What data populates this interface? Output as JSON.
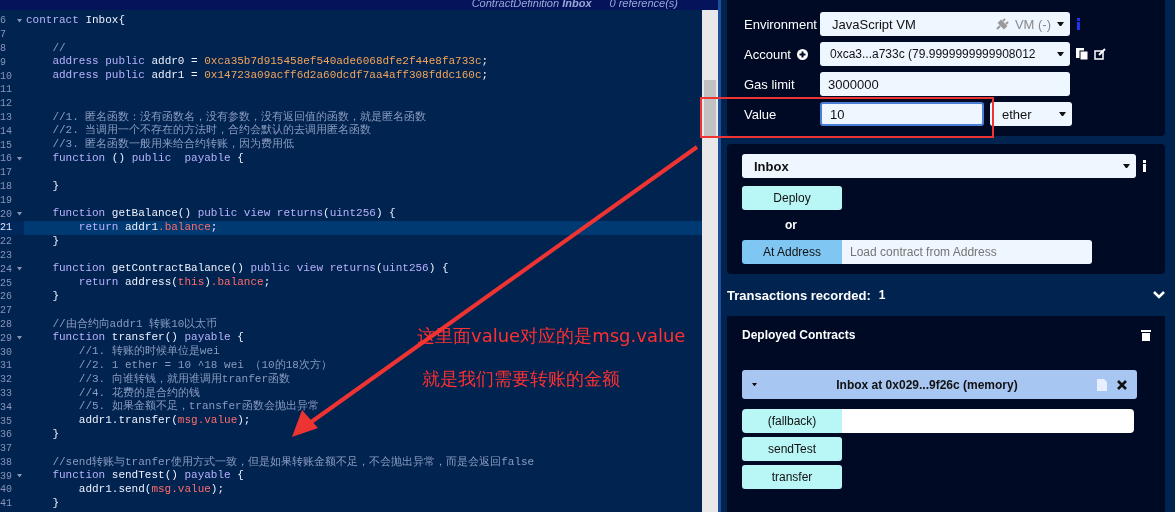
{
  "editor": {
    "header": {
      "symbol": "ContractDefinition",
      "name": "Inbox",
      "references": "0 reference(s)"
    },
    "lines": [
      {
        "number": "6",
        "foldable": true,
        "highlighted": false,
        "tokens": [
          {
            "kind": "keyword",
            "text": "contract"
          },
          {
            "kind": "text",
            "text": " Inbox{"
          }
        ]
      },
      {
        "number": "7",
        "foldable": false,
        "highlighted": false
      },
      {
        "number": "8",
        "foldable": false,
        "highlighted": false,
        "tokens": [
          {
            "kind": "comment",
            "text": "    //"
          }
        ]
      },
      {
        "number": "9",
        "foldable": false,
        "highlighted": false,
        "tokens": [
          {
            "kind": "keyword",
            "text": "    address public"
          },
          {
            "kind": "text",
            "text": " addr0 = "
          },
          {
            "kind": "number",
            "text": "0xca35b7d915458ef540ade6068dfe2f44e8fa733c"
          },
          {
            "kind": "text",
            "text": ";"
          }
        ]
      },
      {
        "number": "10",
        "foldable": false,
        "highlighted": false,
        "tokens": [
          {
            "kind": "keyword",
            "text": "    address public"
          },
          {
            "kind": "text",
            "text": " addr1 = "
          },
          {
            "kind": "number",
            "text": "0x14723a09acff6d2a60dcdf7aa4aff308fddc160c"
          },
          {
            "kind": "text",
            "text": ";"
          }
        ]
      },
      {
        "number": "11",
        "foldable": false,
        "highlighted": false
      },
      {
        "number": "12",
        "foldable": false,
        "highlighted": false
      },
      {
        "number": "13",
        "foldable": false,
        "highlighted": false,
        "tokens": [
          {
            "kind": "comment",
            "text": "    //1. 匿名函数：没有函数名，没有参数，没有返回值的函数，就是匿名函数"
          }
        ]
      },
      {
        "number": "14",
        "foldable": false,
        "highlighted": false,
        "tokens": [
          {
            "kind": "comment",
            "text": "    //2. 当调用一个不存在的方法时，合约会默认的去调用匿名函数"
          }
        ]
      },
      {
        "number": "15",
        "foldable": false,
        "highlighted": false,
        "tokens": [
          {
            "kind": "comment",
            "text": "    //3. 匿名函数一般用来给合约转账，因为费用低"
          }
        ]
      },
      {
        "number": "16",
        "foldable": true,
        "highlighted": false,
        "tokens": [
          {
            "kind": "keyword",
            "text": "    function"
          },
          {
            "kind": "text",
            "text": " () "
          },
          {
            "kind": "keyword",
            "text": "public  payable"
          },
          {
            "kind": "text",
            "text": " {"
          }
        ]
      },
      {
        "number": "17",
        "foldable": false,
        "highlighted": false
      },
      {
        "number": "18",
        "foldable": false,
        "highlighted": false,
        "tokens": [
          {
            "kind": "text",
            "text": "    }"
          }
        ]
      },
      {
        "number": "19",
        "foldable": false,
        "highlighted": false
      },
      {
        "number": "20",
        "foldable": true,
        "highlighted": false,
        "tokens": [
          {
            "kind": "keyword",
            "text": "    function"
          },
          {
            "kind": "text",
            "text": " getBalance() "
          },
          {
            "kind": "keyword",
            "text": "public view returns"
          },
          {
            "kind": "text",
            "text": "("
          },
          {
            "kind": "keyword",
            "text": "uint256"
          },
          {
            "kind": "text",
            "text": ") {"
          }
        ]
      },
      {
        "number": "21",
        "foldable": false,
        "highlighted": true,
        "tokens": [
          {
            "kind": "keyword",
            "text": "        return"
          },
          {
            "kind": "text",
            "text": " addr1"
          },
          {
            "kind": "member",
            "text": ".balance"
          },
          {
            "kind": "text",
            "text": ";"
          }
        ]
      },
      {
        "number": "22",
        "foldable": false,
        "highlighted": false,
        "tokens": [
          {
            "kind": "text",
            "text": "    }"
          }
        ]
      },
      {
        "number": "23",
        "foldable": false,
        "highlighted": false
      },
      {
        "number": "24",
        "foldable": true,
        "highlighted": false,
        "tokens": [
          {
            "kind": "keyword",
            "text": "    function"
          },
          {
            "kind": "text",
            "text": " getContractBalance() "
          },
          {
            "kind": "keyword",
            "text": "public view returns"
          },
          {
            "kind": "text",
            "text": "("
          },
          {
            "kind": "keyword",
            "text": "uint256"
          },
          {
            "kind": "text",
            "text": ") {"
          }
        ]
      },
      {
        "number": "25",
        "foldable": false,
        "highlighted": false,
        "tokens": [
          {
            "kind": "keyword",
            "text": "        return"
          },
          {
            "kind": "text",
            "text": " address("
          },
          {
            "kind": "member",
            "text": "this"
          },
          {
            "kind": "text",
            "text": ")"
          },
          {
            "kind": "member",
            "text": ".balance"
          },
          {
            "kind": "text",
            "text": ";"
          }
        ]
      },
      {
        "number": "26",
        "foldable": false,
        "highlighted": false,
        "tokens": [
          {
            "kind": "text",
            "text": "    }"
          }
        ]
      },
      {
        "number": "27",
        "foldable": false,
        "highlighted": false
      },
      {
        "number": "28",
        "foldable": false,
        "highlighted": false,
        "tokens": [
          {
            "kind": "comment",
            "text": "    //由合约向addr1 转账10以太币"
          }
        ]
      },
      {
        "number": "29",
        "foldable": true,
        "highlighted": false,
        "tokens": [
          {
            "kind": "keyword",
            "text": "    function"
          },
          {
            "kind": "text",
            "text": " transfer() "
          },
          {
            "kind": "keyword",
            "text": "payable"
          },
          {
            "kind": "text",
            "text": " {"
          }
        ]
      },
      {
        "number": "30",
        "foldable": false,
        "highlighted": false,
        "tokens": [
          {
            "kind": "comment",
            "text": "        //1. 转账的时候单位是wei"
          }
        ]
      },
      {
        "number": "31",
        "foldable": false,
        "highlighted": false,
        "tokens": [
          {
            "kind": "comment",
            "text": "        //2. 1 ether = 10 ^18 wei （10的18次方）"
          }
        ]
      },
      {
        "number": "32",
        "foldable": false,
        "highlighted": false,
        "tokens": [
          {
            "kind": "comment",
            "text": "        //3. 向谁转钱，就用谁调用tranfer函数"
          }
        ]
      },
      {
        "number": "33",
        "foldable": false,
        "highlighted": false,
        "tokens": [
          {
            "kind": "comment",
            "text": "        //4. 花费的是合约的钱"
          }
        ]
      },
      {
        "number": "34",
        "foldable": false,
        "highlighted": false,
        "tokens": [
          {
            "kind": "comment",
            "text": "        //5. 如果金额不足，transfer函数会抛出异常"
          }
        ]
      },
      {
        "number": "35",
        "foldable": false,
        "highlighted": false,
        "tokens": [
          {
            "kind": "text",
            "text": "        addr1.transfer("
          },
          {
            "kind": "member",
            "text": "msg.value"
          },
          {
            "kind": "text",
            "text": ");"
          }
        ]
      },
      {
        "number": "36",
        "foldable": false,
        "highlighted": false,
        "tokens": [
          {
            "kind": "text",
            "text": "    }"
          }
        ]
      },
      {
        "number": "37",
        "foldable": false,
        "highlighted": false
      },
      {
        "number": "38",
        "foldable": false,
        "highlighted": false,
        "tokens": [
          {
            "kind": "comment",
            "text": "    //send转账与tranfer使用方式一致，但是如果转账金额不足，不会抛出异常，而是会返回false"
          }
        ]
      },
      {
        "number": "39",
        "foldable": true,
        "highlighted": false,
        "tokens": [
          {
            "kind": "keyword",
            "text": "    function"
          },
          {
            "kind": "text",
            "text": " sendTest() "
          },
          {
            "kind": "keyword",
            "text": "payable"
          },
          {
            "kind": "text",
            "text": " {"
          }
        ]
      },
      {
        "number": "40",
        "foldable": false,
        "highlighted": false,
        "tokens": [
          {
            "kind": "text",
            "text": "        addr1.send("
          },
          {
            "kind": "member",
            "text": "msg.value"
          },
          {
            "kind": "text",
            "text": ");"
          }
        ]
      },
      {
        "number": "41",
        "foldable": false,
        "highlighted": false,
        "tokens": [
          {
            "kind": "text",
            "text": "    }"
          }
        ]
      }
    ]
  },
  "run_panel": {
    "environment": {
      "label": "Environment",
      "value": "JavaScript VM",
      "provider": "VM (-)"
    },
    "account": {
      "label": "Account",
      "value": "0xca3...a733c (79.9999999999908012"
    },
    "gas_limit": {
      "label": "Gas limit",
      "value": "3000000"
    },
    "value": {
      "label": "Value",
      "value": "10",
      "unit": "ether"
    }
  },
  "deploy_panel": {
    "contract": "Inbox",
    "deploy_button": "Deploy",
    "or_text": "or",
    "at_address_button": "At Address",
    "at_address_placeholder": "Load contract from Address"
  },
  "transactions": {
    "label": "Transactions recorded:",
    "count": "1"
  },
  "deployed": {
    "title": "Deployed Contracts",
    "instance": "Inbox at 0x029...9f26c (memory)",
    "functions": [
      {
        "label": "(fallback)",
        "kind": "input"
      },
      {
        "label": "sendTest",
        "kind": "button"
      },
      {
        "label": "transfer",
        "kind": "button"
      }
    ]
  },
  "annotations": [
    "这里面value对应的是msg.value",
    "就是我们需要转账的金额"
  ]
}
